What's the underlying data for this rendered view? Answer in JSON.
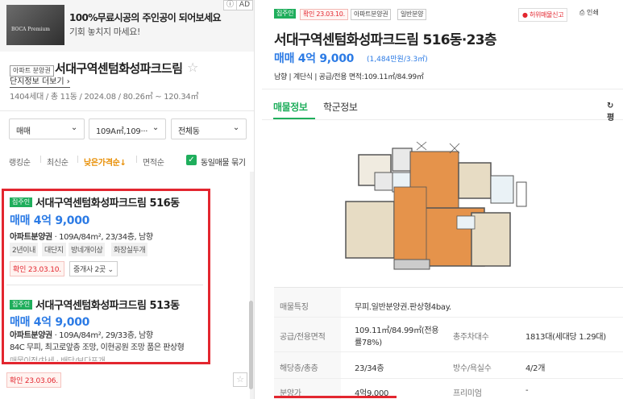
{
  "ad": {
    "thumb_text": "BOCA Premium",
    "title": "100%무료시공의 주인공이 되어보세요",
    "subtitle": "기회 놓치지 마세요!",
    "badge": "AD"
  },
  "complex": {
    "type_tag": "아파트 분양권",
    "name": "서대구역센텀화성파크드림",
    "info_link": "단지정보 더보기",
    "info": "1404세대 / 총 11동 / 2024.08 / 80.26㎡ ~ 120.34㎡"
  },
  "filters": {
    "trade": "매매",
    "area": "109A㎡,109···",
    "building": "전체동"
  },
  "sort": {
    "items": [
      "랭킹순",
      "최신순",
      "낮은가격순↓",
      "면적순"
    ],
    "same_listing": "동일매물 묶기"
  },
  "listings": [
    {
      "badge": "집주인",
      "title": "서대구역센텀화성파크드림 516동",
      "price": "매매 4억 9,000",
      "spec_type": "아파트분양권",
      "spec": "· 109A/84m², 23/34층, 남향",
      "tags": [
        "2년이내",
        "대단지",
        "방네개이상",
        "화장실두개"
      ],
      "confirm": "확인 23.03.10.",
      "broker": "중개사 2곳"
    },
    {
      "badge": "집주인",
      "title": "서대구역센텀화성파크드림 513동",
      "price": "매매 4억 9,000",
      "spec_type": "아파트분양권",
      "spec": "· 109A/84m², 29/33층, 남향",
      "desc": "84C 무피, 최고로앞층 조망, 이현공원 조망 품은 판상형",
      "desc2": "매물이점/차세 · 배당/보다포개",
      "confirm": "확인 23.03.06."
    }
  ],
  "detail": {
    "badges": [
      "집주인",
      "확인 23.03.10.",
      "아파트분양권",
      "일반분양"
    ],
    "report": "허위매물신고",
    "print": "인쇄",
    "title": "서대구역센텀화성파크드림 516동·23층",
    "price": "매매 4억 9,000",
    "price_sub": "(1,484만원/3.3㎡)",
    "summary": "남향 | 계단식 | 공급/전용 면적:109.11㎡/84.99㎡",
    "tabs": [
      "매물정보",
      "학군정보"
    ],
    "refresh": "↻ 평",
    "table": {
      "feature_label": "매물특징",
      "feature": "무피.일반분양권.판상형4bay.",
      "area_label": "공급/전용면적",
      "area": "109.11㎡/84.99㎡(전용률78%)",
      "households_label": "총주차대수",
      "households": "1813대(세대당 1.29대)",
      "floor_label": "해당층/총층",
      "floor": "23/34층",
      "rooms_label": "방수/욕실수",
      "rooms": "4/2개",
      "sale_label": "분양가",
      "sale": "4억9,000",
      "premium_label": "프리미엄",
      "premium": "-"
    }
  },
  "colors": {
    "green": "#1fae5c",
    "blue": "#2c7be5",
    "red": "#e3262f",
    "orange": "#e88d00"
  }
}
